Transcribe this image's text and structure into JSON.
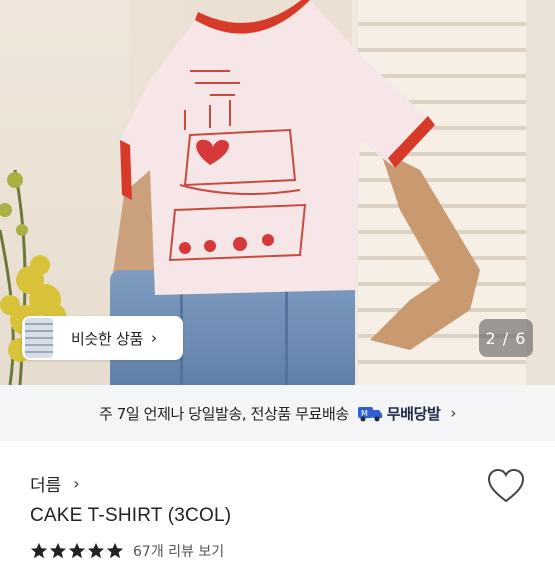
{
  "product_image": {
    "similar_label": "비슷한 상품",
    "page_current": "2",
    "page_total": "6",
    "page_text": "2 / 6"
  },
  "shipping": {
    "text": "주 7일 언제나 당일발송, 전상품 무료배송",
    "brand": "무배당발",
    "icon": "delivery-truck-icon"
  },
  "product": {
    "shop_name": "더름",
    "title": "CAKE T-SHIRT (3COL)",
    "rating_stars": 5,
    "review_text": "67개 리뷰 보기"
  },
  "colors": {
    "accent_red": "#d83a2a",
    "shipping_bg": "#f4f5f7"
  }
}
